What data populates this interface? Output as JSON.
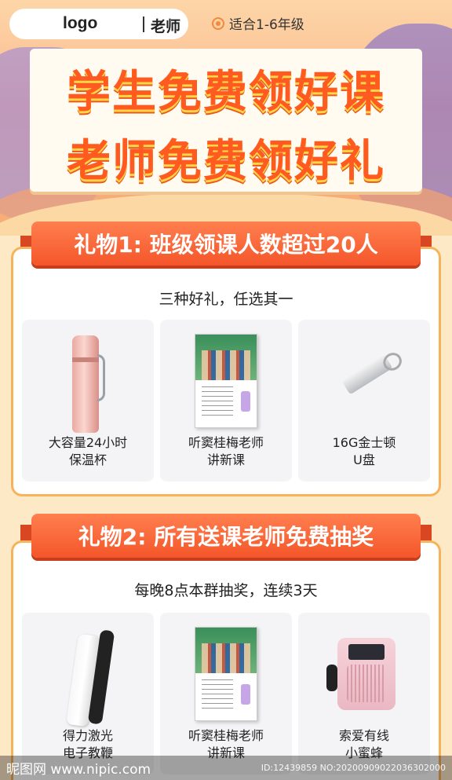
{
  "header": {
    "logo": "logo",
    "role": "老师",
    "grade": "适合1-6年级"
  },
  "hero": {
    "line1": "学生免费领好课",
    "line2": "老师免费领好礼"
  },
  "section1": {
    "ribbon": "礼物1: 班级领课人数超过20人",
    "subtitle": "三种好礼，任选其一",
    "items": [
      {
        "line1": "大容量24小时",
        "line2": "保温杯",
        "icon": "thermos-icon"
      },
      {
        "line1": "听窦桂梅老师",
        "line2": "讲新课",
        "icon": "book-icon"
      },
      {
        "line1": "16G金士顿",
        "line2": "U盘",
        "icon": "usb-drive-icon"
      }
    ]
  },
  "section2": {
    "ribbon": "礼物2: 所有送课老师免费抽奖",
    "subtitle": "每晚8点本群抽奖，连续3天",
    "items": [
      {
        "line1": "得力激光",
        "line2": "电子教鞭",
        "icon": "laser-pointer-icon"
      },
      {
        "line1": "听窦桂梅老师",
        "line2": "讲新课",
        "icon": "book-icon"
      },
      {
        "line1": "索爱有线",
        "line2": "小蜜蜂",
        "icon": "speaker-icon"
      }
    ]
  },
  "watermark": {
    "site": "昵图网 www.nipic.com",
    "id": "ID:12439859 NO:20200909022036302000"
  }
}
